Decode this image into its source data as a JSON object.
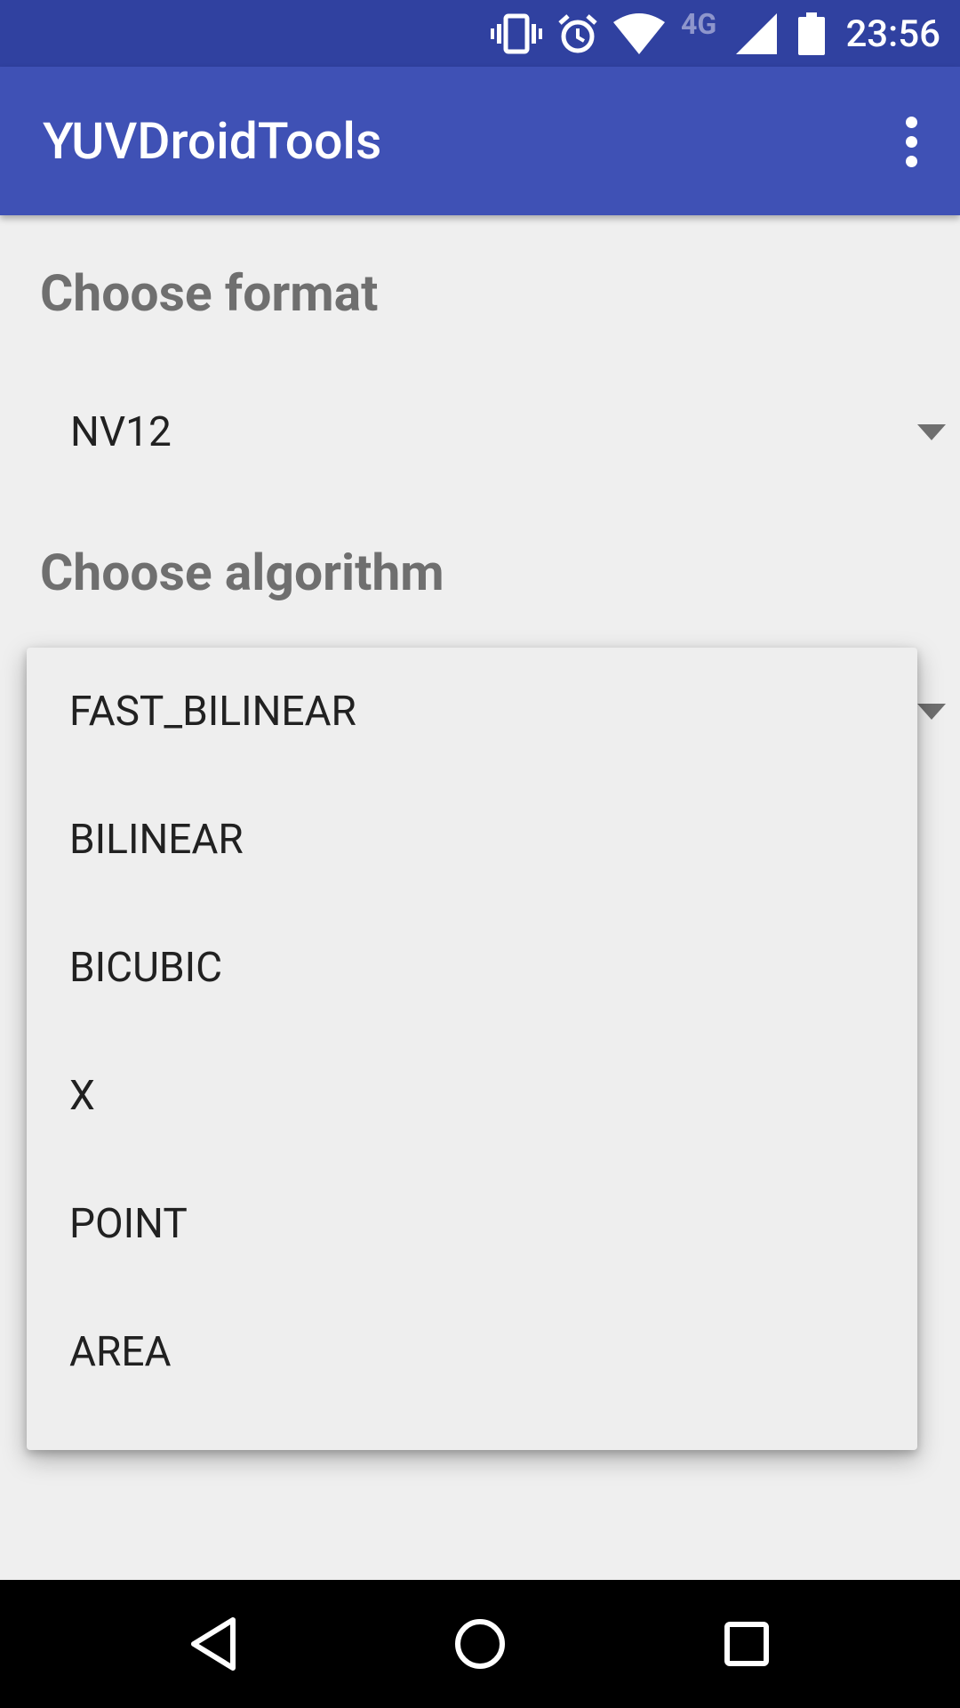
{
  "status_bar": {
    "time": "23:56",
    "network_type": "4G",
    "icons": [
      "vibrate-icon",
      "alarm-icon",
      "wifi-icon",
      "cell-signal-icon",
      "battery-icon"
    ]
  },
  "app_bar": {
    "title": "YUVDroidTools",
    "overflow_icon": "more-vert-icon"
  },
  "format_section": {
    "label": "Choose format",
    "selected": "NV12"
  },
  "algorithm_section": {
    "label": "Choose algorithm",
    "options": [
      "FAST_BILINEAR",
      "BILINEAR",
      "BICUBIC",
      "X",
      "POINT",
      "AREA"
    ]
  },
  "nav_bar": {
    "icons": [
      "back-icon",
      "home-icon",
      "recents-icon"
    ]
  },
  "colors": {
    "status_bar": "#3041a0",
    "app_bar": "#3f51b5",
    "background": "#efefef",
    "section_title": "#6f6f6f"
  }
}
